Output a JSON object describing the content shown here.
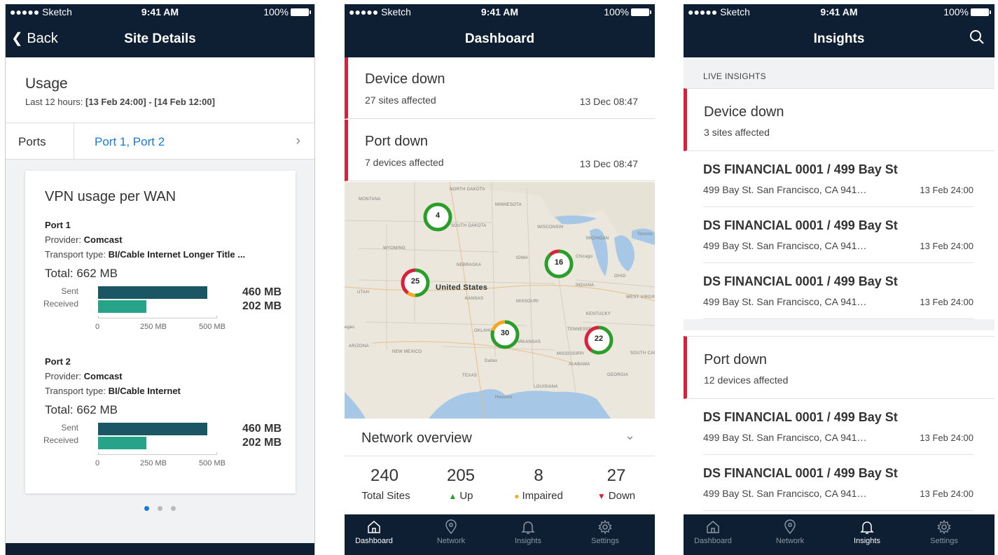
{
  "status_bar": {
    "carrier": "●●●●● Sketch",
    "time": "9:41 AM",
    "battery": "100%"
  },
  "site_details": {
    "back_label": "Back",
    "title": "Site Details",
    "usage_title": "Usage",
    "usage_sub_prefix": "Last 12 hours:",
    "usage_sub_range": "[13 Feb 24:00] - [14 Feb 12:00]",
    "ports_label": "Ports",
    "ports_value": "Port 1, Port 2",
    "card_title": "VPN usage per WAN",
    "ports": [
      {
        "name": "Port 1",
        "provider_label": "Provider:",
        "provider": "Comcast",
        "transport_label": "Transport type:",
        "transport": "BI/Cable Internet Longer Title ...",
        "total": "Total: 662 MB",
        "sent_label": "Sent",
        "received_label": "Received",
        "sent_value": "460 MB",
        "received_value": "202 MB",
        "sent_mb": 460,
        "received_mb": 202,
        "ticks": [
          "0",
          "250 MB",
          "500 MB"
        ]
      },
      {
        "name": "Port 2",
        "provider_label": "Provider:",
        "provider": "Comcast",
        "transport_label": "Transport type:",
        "transport": "BI/Cable Internet",
        "total": "Total: 662 MB",
        "sent_label": "Sent",
        "received_label": "Received",
        "sent_value": "460 MB",
        "received_value": "202 MB",
        "sent_mb": 460,
        "received_mb": 202,
        "ticks": [
          "0",
          "250 MB",
          "500 MB"
        ]
      }
    ],
    "page_count": 3,
    "active_page": 1
  },
  "dashboard": {
    "title": "Dashboard",
    "alerts": [
      {
        "title": "Device down",
        "sub": "27 sites affected",
        "date": "13 Dec 08:47"
      },
      {
        "title": "Port down",
        "sub": "7 devices affected",
        "date": "13 Dec 08:47"
      }
    ],
    "map": {
      "labels": [
        "MONTANA",
        "NORTH DAKOTA",
        "MINNESOTA",
        "WYOMING",
        "SOUTH DAKOTA",
        "WISCONSIN",
        "MICHIGAN",
        "Toronto",
        "NEBRASKA",
        "IOWA",
        "Chicago",
        "UTAH",
        "United States",
        "KANSAS",
        "MISSOURI",
        "INDIANA",
        "OHIO",
        "WEST VIRGINIA",
        "KENTUCKY",
        "Vegas",
        "OKLAHOMA",
        "ARKANSAS",
        "TENNESSEE",
        "ARIZONA",
        "NEW MEXICO",
        "Dallas",
        "MISSISSIPPI",
        "ALABAMA",
        "SOUTH CAROLINA",
        "GEORGIA",
        "TEXAS",
        "LOUISIANA",
        "Houston"
      ],
      "clusters": [
        {
          "count": "4",
          "up": 1.0,
          "impaired": 0.0,
          "down": 0.0
        },
        {
          "count": "16",
          "up": 0.88,
          "impaired": 0.0,
          "down": 0.12
        },
        {
          "count": "25",
          "up": 0.5,
          "impaired": 0.1,
          "down": 0.4
        },
        {
          "count": "30",
          "up": 0.8,
          "impaired": 0.2,
          "down": 0.0
        },
        {
          "count": "22",
          "up": 0.6,
          "impaired": 0.0,
          "down": 0.4
        }
      ]
    },
    "overview_title": "Network overview",
    "stats": [
      {
        "value": "240",
        "label": "Total Sites",
        "marker": ""
      },
      {
        "value": "205",
        "label": "Up",
        "marker": "▲"
      },
      {
        "value": "8",
        "label": "Impaired",
        "marker": "●"
      },
      {
        "value": "27",
        "label": "Down",
        "marker": "▼"
      }
    ]
  },
  "tabs": [
    {
      "label": "Dashboard",
      "icon": "home-icon"
    },
    {
      "label": "Network",
      "icon": "map-pin-icon"
    },
    {
      "label": "Insights",
      "icon": "bell-icon"
    },
    {
      "label": "Settings",
      "icon": "gear-icon"
    }
  ],
  "insights": {
    "title": "Insights",
    "section": "LIVE INSIGHTS",
    "groups": [
      {
        "title": "Device down",
        "sub": "3 sites affected",
        "sites": [
          {
            "name": "DS FINANCIAL 0001 / 499 Bay St",
            "address": "499 Bay St. San Francisco, CA 941…",
            "date": "13 Feb 24:00"
          },
          {
            "name": "DS FINANCIAL 0001 / 499 Bay St",
            "address": "499 Bay St. San Francisco, CA 941…",
            "date": "13 Feb 24:00"
          },
          {
            "name": "DS FINANCIAL 0001 / 499 Bay St",
            "address": "499 Bay St. San Francisco, CA 941…",
            "date": "13 Feb 24:00"
          }
        ]
      },
      {
        "title": "Port down",
        "sub": "12 devices affected",
        "sites": [
          {
            "name": "DS FINANCIAL 0001 / 499 Bay St",
            "address": "499 Bay St. San Francisco, CA 941…",
            "date": "13 Feb 24:00"
          },
          {
            "name": "DS FINANCIAL 0001 / 499 Bay St",
            "address": "499 Bay St. San Francisco, CA 941…",
            "date": "13 Feb 24:00"
          }
        ]
      }
    ]
  },
  "colors": {
    "navy": "#0e1e33",
    "accent_blue": "#1a7bd6",
    "alert_red": "#d8213b",
    "up_green": "#2a9d2a",
    "impaired_orange": "#f5a623",
    "sent_bar": "#1b5665",
    "received_bar": "#26a389"
  }
}
